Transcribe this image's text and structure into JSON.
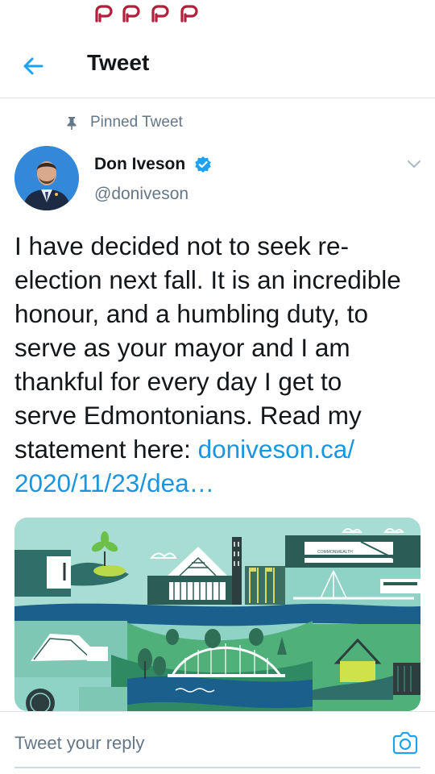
{
  "status_bar": {
    "notification_icons": [
      "parler-icon",
      "parler-icon",
      "parler-icon",
      "parler-icon"
    ],
    "notification_color": "#b01f3c"
  },
  "header": {
    "title": "Tweet",
    "back_icon": "arrow-left-icon",
    "accent_color": "#1da1f2"
  },
  "tweet": {
    "pinned_label": "Pinned Tweet",
    "author_name": "Don Iveson",
    "author_handle": "@doniveson",
    "verified": true,
    "text": "I have decided not to seek re-\nelection next fall. It is an incredible\nhonour, and a humbling duty, to\nserve as your mayor and I am\nthankful for every day I get to\nserve Edmontonians. Read my\nstatement here: ",
    "link_text": "doniveson.ca/\n2020/11/23/dea…",
    "link_color": "#1b95e0",
    "media": {
      "sign_text": "COMMONWEALTH"
    }
  },
  "reply_bar": {
    "placeholder": "Tweet your reply",
    "camera_icon": "camera-icon"
  }
}
